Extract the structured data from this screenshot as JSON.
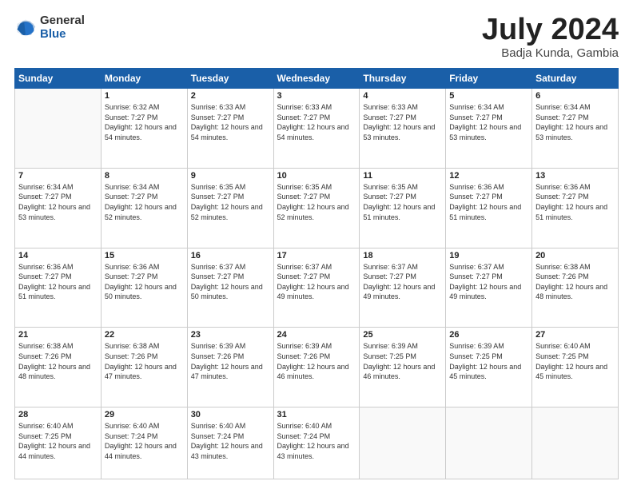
{
  "logo": {
    "general": "General",
    "blue": "Blue"
  },
  "header": {
    "month": "July 2024",
    "location": "Badja Kunda, Gambia"
  },
  "weekdays": [
    "Sunday",
    "Monday",
    "Tuesday",
    "Wednesday",
    "Thursday",
    "Friday",
    "Saturday"
  ],
  "weeks": [
    [
      {
        "day": "",
        "sunrise": "",
        "sunset": "",
        "daylight": ""
      },
      {
        "day": "1",
        "sunrise": "Sunrise: 6:32 AM",
        "sunset": "Sunset: 7:27 PM",
        "daylight": "Daylight: 12 hours and 54 minutes."
      },
      {
        "day": "2",
        "sunrise": "Sunrise: 6:33 AM",
        "sunset": "Sunset: 7:27 PM",
        "daylight": "Daylight: 12 hours and 54 minutes."
      },
      {
        "day": "3",
        "sunrise": "Sunrise: 6:33 AM",
        "sunset": "Sunset: 7:27 PM",
        "daylight": "Daylight: 12 hours and 54 minutes."
      },
      {
        "day": "4",
        "sunrise": "Sunrise: 6:33 AM",
        "sunset": "Sunset: 7:27 PM",
        "daylight": "Daylight: 12 hours and 53 minutes."
      },
      {
        "day": "5",
        "sunrise": "Sunrise: 6:34 AM",
        "sunset": "Sunset: 7:27 PM",
        "daylight": "Daylight: 12 hours and 53 minutes."
      },
      {
        "day": "6",
        "sunrise": "Sunrise: 6:34 AM",
        "sunset": "Sunset: 7:27 PM",
        "daylight": "Daylight: 12 hours and 53 minutes."
      }
    ],
    [
      {
        "day": "7",
        "sunrise": "Sunrise: 6:34 AM",
        "sunset": "Sunset: 7:27 PM",
        "daylight": "Daylight: 12 hours and 53 minutes."
      },
      {
        "day": "8",
        "sunrise": "Sunrise: 6:34 AM",
        "sunset": "Sunset: 7:27 PM",
        "daylight": "Daylight: 12 hours and 52 minutes."
      },
      {
        "day": "9",
        "sunrise": "Sunrise: 6:35 AM",
        "sunset": "Sunset: 7:27 PM",
        "daylight": "Daylight: 12 hours and 52 minutes."
      },
      {
        "day": "10",
        "sunrise": "Sunrise: 6:35 AM",
        "sunset": "Sunset: 7:27 PM",
        "daylight": "Daylight: 12 hours and 52 minutes."
      },
      {
        "day": "11",
        "sunrise": "Sunrise: 6:35 AM",
        "sunset": "Sunset: 7:27 PM",
        "daylight": "Daylight: 12 hours and 51 minutes."
      },
      {
        "day": "12",
        "sunrise": "Sunrise: 6:36 AM",
        "sunset": "Sunset: 7:27 PM",
        "daylight": "Daylight: 12 hours and 51 minutes."
      },
      {
        "day": "13",
        "sunrise": "Sunrise: 6:36 AM",
        "sunset": "Sunset: 7:27 PM",
        "daylight": "Daylight: 12 hours and 51 minutes."
      }
    ],
    [
      {
        "day": "14",
        "sunrise": "Sunrise: 6:36 AM",
        "sunset": "Sunset: 7:27 PM",
        "daylight": "Daylight: 12 hours and 51 minutes."
      },
      {
        "day": "15",
        "sunrise": "Sunrise: 6:36 AM",
        "sunset": "Sunset: 7:27 PM",
        "daylight": "Daylight: 12 hours and 50 minutes."
      },
      {
        "day": "16",
        "sunrise": "Sunrise: 6:37 AM",
        "sunset": "Sunset: 7:27 PM",
        "daylight": "Daylight: 12 hours and 50 minutes."
      },
      {
        "day": "17",
        "sunrise": "Sunrise: 6:37 AM",
        "sunset": "Sunset: 7:27 PM",
        "daylight": "Daylight: 12 hours and 49 minutes."
      },
      {
        "day": "18",
        "sunrise": "Sunrise: 6:37 AM",
        "sunset": "Sunset: 7:27 PM",
        "daylight": "Daylight: 12 hours and 49 minutes."
      },
      {
        "day": "19",
        "sunrise": "Sunrise: 6:37 AM",
        "sunset": "Sunset: 7:27 PM",
        "daylight": "Daylight: 12 hours and 49 minutes."
      },
      {
        "day": "20",
        "sunrise": "Sunrise: 6:38 AM",
        "sunset": "Sunset: 7:26 PM",
        "daylight": "Daylight: 12 hours and 48 minutes."
      }
    ],
    [
      {
        "day": "21",
        "sunrise": "Sunrise: 6:38 AM",
        "sunset": "Sunset: 7:26 PM",
        "daylight": "Daylight: 12 hours and 48 minutes."
      },
      {
        "day": "22",
        "sunrise": "Sunrise: 6:38 AM",
        "sunset": "Sunset: 7:26 PM",
        "daylight": "Daylight: 12 hours and 47 minutes."
      },
      {
        "day": "23",
        "sunrise": "Sunrise: 6:39 AM",
        "sunset": "Sunset: 7:26 PM",
        "daylight": "Daylight: 12 hours and 47 minutes."
      },
      {
        "day": "24",
        "sunrise": "Sunrise: 6:39 AM",
        "sunset": "Sunset: 7:26 PM",
        "daylight": "Daylight: 12 hours and 46 minutes."
      },
      {
        "day": "25",
        "sunrise": "Sunrise: 6:39 AM",
        "sunset": "Sunset: 7:25 PM",
        "daylight": "Daylight: 12 hours and 46 minutes."
      },
      {
        "day": "26",
        "sunrise": "Sunrise: 6:39 AM",
        "sunset": "Sunset: 7:25 PM",
        "daylight": "Daylight: 12 hours and 45 minutes."
      },
      {
        "day": "27",
        "sunrise": "Sunrise: 6:40 AM",
        "sunset": "Sunset: 7:25 PM",
        "daylight": "Daylight: 12 hours and 45 minutes."
      }
    ],
    [
      {
        "day": "28",
        "sunrise": "Sunrise: 6:40 AM",
        "sunset": "Sunset: 7:25 PM",
        "daylight": "Daylight: 12 hours and 44 minutes."
      },
      {
        "day": "29",
        "sunrise": "Sunrise: 6:40 AM",
        "sunset": "Sunset: 7:24 PM",
        "daylight": "Daylight: 12 hours and 44 minutes."
      },
      {
        "day": "30",
        "sunrise": "Sunrise: 6:40 AM",
        "sunset": "Sunset: 7:24 PM",
        "daylight": "Daylight: 12 hours and 43 minutes."
      },
      {
        "day": "31",
        "sunrise": "Sunrise: 6:40 AM",
        "sunset": "Sunset: 7:24 PM",
        "daylight": "Daylight: 12 hours and 43 minutes."
      },
      {
        "day": "",
        "sunrise": "",
        "sunset": "",
        "daylight": ""
      },
      {
        "day": "",
        "sunrise": "",
        "sunset": "",
        "daylight": ""
      },
      {
        "day": "",
        "sunrise": "",
        "sunset": "",
        "daylight": ""
      }
    ]
  ]
}
